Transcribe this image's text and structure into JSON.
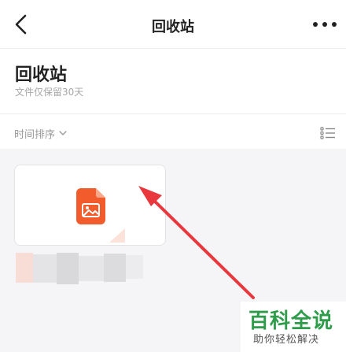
{
  "nav": {
    "title": "回收站",
    "back_icon": "chevron-left-icon",
    "more_icon": "more-horizontal-icon"
  },
  "header": {
    "title": "回收站",
    "subtitle": "文件仅保留30天"
  },
  "sort_bar": {
    "sort_label": "时间排序",
    "sort_icon": "chevron-down-icon",
    "view_icon": "list-view-icon"
  },
  "file_card": {
    "icon": "image-file-icon",
    "icon_color": "#f25c2c"
  },
  "annotation": {
    "arrow_color": "#e8383d"
  },
  "watermark": {
    "title": "百科全说",
    "subtitle": "助你轻松解决"
  },
  "colors": {
    "content_background": "#f5f5f7",
    "subtitle_text": "#a7a7a7",
    "watermark_green": "#2e9c4a"
  }
}
